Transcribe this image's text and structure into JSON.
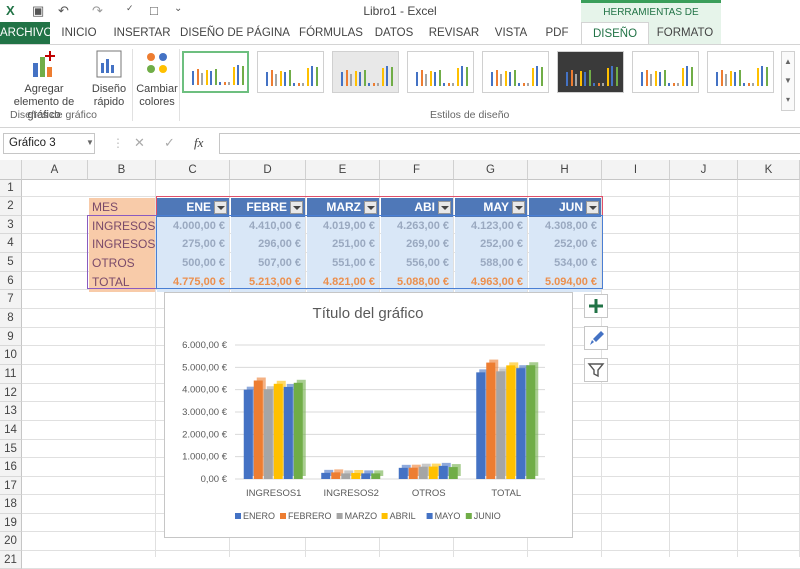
{
  "window": {
    "title": "Libro1 - Excel",
    "context_header": "HERRAMIENTAS DE GRÁFICOS"
  },
  "tabs": [
    {
      "label": "ARCHIVO"
    },
    {
      "label": "INICIO"
    },
    {
      "label": "INSERTAR"
    },
    {
      "label": "DISEÑO DE PÁGINA"
    },
    {
      "label": "FÓRMULAS"
    },
    {
      "label": "DATOS"
    },
    {
      "label": "REVISAR"
    },
    {
      "label": "VISTA"
    },
    {
      "label": "PDF"
    },
    {
      "label": "DISEÑO"
    },
    {
      "label": "FORMATO"
    }
  ],
  "ribbon": {
    "add_element": "Agregar elemento de gráfico",
    "quick_layout": "Diseño rápido",
    "change_colors": "Cambiar colores",
    "group_layouts": "Diseños de gráfico",
    "group_styles": "Estilos de diseño"
  },
  "formula_bar": {
    "name_box": "Gráfico 3",
    "fx": "fx",
    "value": ""
  },
  "columns": [
    "A",
    "B",
    "C",
    "D",
    "E",
    "F",
    "G",
    "H",
    "I",
    "J",
    "K"
  ],
  "rows": [
    "1",
    "2",
    "3",
    "4",
    "5",
    "6",
    "7",
    "8",
    "9",
    "10",
    "11",
    "12",
    "13",
    "14",
    "15",
    "16",
    "17",
    "18",
    "19",
    "20",
    "21"
  ],
  "table": {
    "header": "MES",
    "months": [
      "ENE",
      "FEBRE",
      "MARZ",
      "ABI",
      "MAY",
      "JUN"
    ],
    "rows": [
      {
        "label": "INGRESOS1",
        "values": [
          "4.000,00 €",
          "4.410,00 €",
          "4.019,00 €",
          "4.263,00 €",
          "4.123,00 €",
          "4.308,00 €"
        ]
      },
      {
        "label": "INGRESOS2",
        "values": [
          "275,00 €",
          "296,00 €",
          "251,00 €",
          "269,00 €",
          "252,00 €",
          "252,00 €"
        ]
      },
      {
        "label": "OTROS",
        "values": [
          "500,00 €",
          "507,00 €",
          "551,00 €",
          "556,00 €",
          "588,00 €",
          "534,00 €"
        ]
      },
      {
        "label": "TOTAL",
        "values": [
          "4.775,00 €",
          "5.213,00 €",
          "4.821,00 €",
          "5.088,00 €",
          "4.963,00 €",
          "5.094,00 €"
        ]
      }
    ]
  },
  "colors": {
    "accent": "#217346",
    "series": [
      "#4472c4",
      "#ed7d31",
      "#a5a5a5",
      "#ffc000",
      "#4472c4",
      "#70ad47"
    ]
  },
  "chart_data": {
    "type": "bar",
    "title": "Título del gráfico",
    "categories": [
      "INGRESOS1",
      "INGRESOS2",
      "OTROS",
      "TOTAL"
    ],
    "series": [
      {
        "name": "ENERO",
        "values": [
          4000,
          275,
          500,
          4775
        ]
      },
      {
        "name": "FEBRERO",
        "values": [
          4410,
          296,
          507,
          5213
        ]
      },
      {
        "name": "MARZO",
        "values": [
          4019,
          251,
          551,
          4821
        ]
      },
      {
        "name": "ABRIL",
        "values": [
          4263,
          269,
          556,
          5088
        ]
      },
      {
        "name": "MAYO",
        "values": [
          4123,
          252,
          588,
          4963
        ]
      },
      {
        "name": "JUNIO",
        "values": [
          4308,
          252,
          534,
          5094
        ]
      }
    ],
    "y_ticks": [
      "0,00 €",
      "1.000,00 €",
      "2.000,00 €",
      "3.000,00 €",
      "4.000,00 €",
      "5.000,00 €",
      "6.000,00 €"
    ],
    "ylim": [
      0,
      6000
    ],
    "legend": "bottom",
    "grid": true
  }
}
